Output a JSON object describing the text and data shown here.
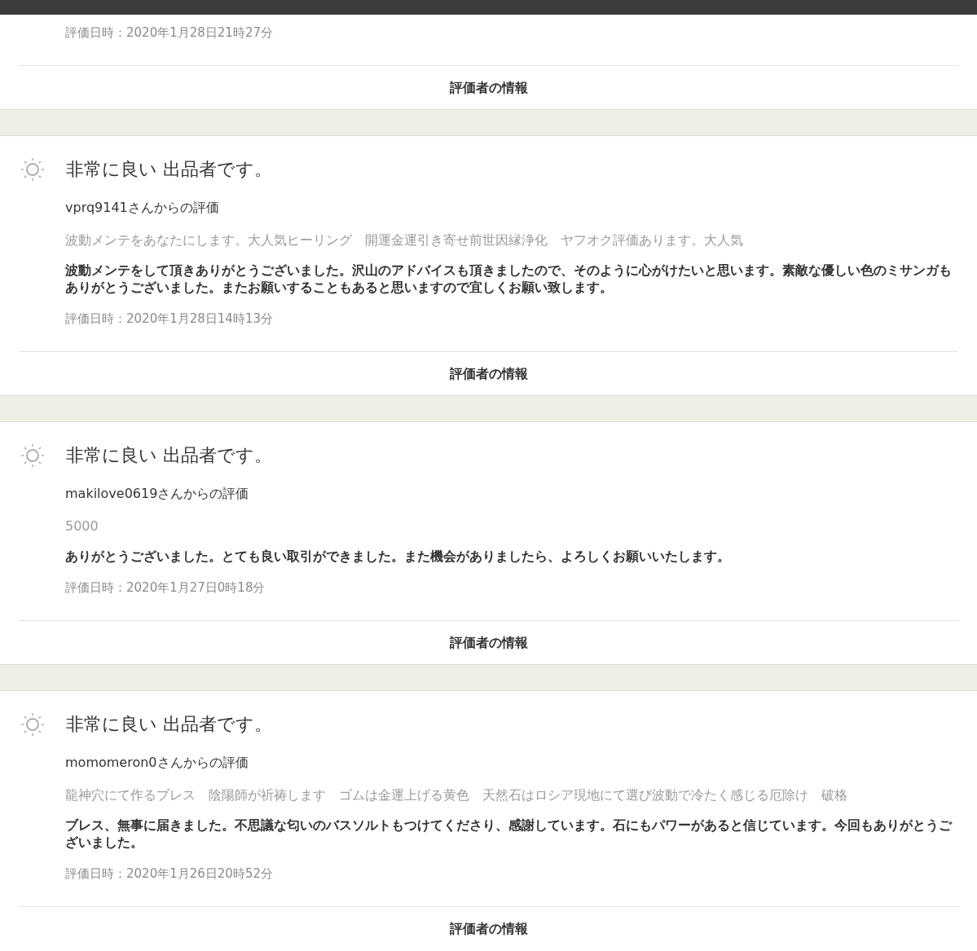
{
  "top_fragment": {
    "date": "評価日時：2020年1月28日21時27分",
    "link": "評価者の情報"
  },
  "reviews": [
    {
      "rating": "非常に良い 出品者です。",
      "reviewer": "vprq9141さんからの評価",
      "item_title": "波動メンテをあなたにします。大人気ヒーリング　開運金運引き寄せ前世因縁浄化　ヤフオク評価あります。大人気",
      "comment": "波動メンテをして頂きありがとうございました。沢山のアドバイスも頂きましたので、そのように心がけたいと思います。素敵な優しい色のミサンガもありがとうございました。またお願いすることもあると思いますので宜しくお願い致します。",
      "date": "評価日時：2020年1月28日14時13分",
      "link": "評価者の情報"
    },
    {
      "rating": "非常に良い 出品者です。",
      "reviewer": "makilove0619さんからの評価",
      "item_title": "5000",
      "comment": "ありがとうございました。とても良い取引ができました。また機会がありましたら、よろしくお願いいたします。",
      "date": "評価日時：2020年1月27日0時18分",
      "link": "評価者の情報"
    },
    {
      "rating": "非常に良い 出品者です。",
      "reviewer": "momomeron0さんからの評価",
      "item_title": "龍神穴にて作るブレス　陰陽師が祈祷します　ゴムは金運上げる黄色　天然石はロシア現地にて選び波動で冷たく感じる厄除け　破格",
      "comment": "ブレス、無事に届きました。不思議な匂いのバスソルトもつけてくださり、感謝しています。石にもパワーがあると信じています。今回もありがとうございました。",
      "date": "評価日時：2020年1月26日20時52分",
      "link": "評価者の情報"
    }
  ]
}
